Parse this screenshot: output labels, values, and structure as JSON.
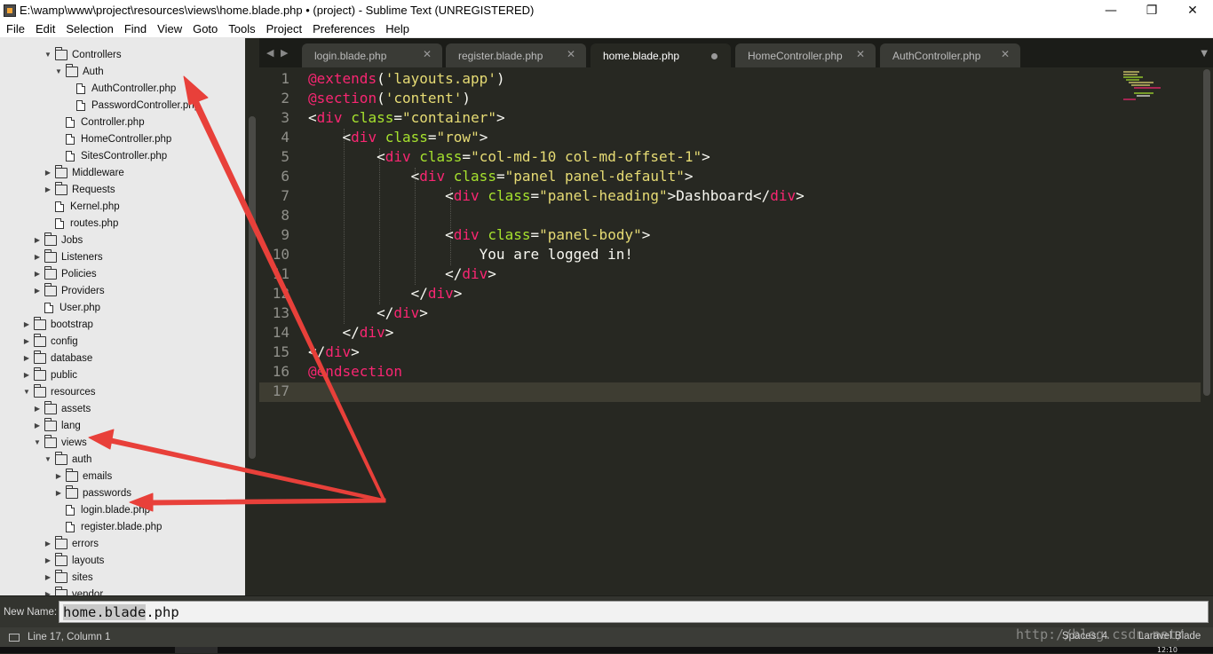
{
  "window": {
    "title": "E:\\wamp\\www\\project\\resources\\views\\home.blade.php • (project) - Sublime Text (UNREGISTERED)",
    "minimize": "—",
    "maximize": "❐",
    "close": "✕"
  },
  "menu": [
    "File",
    "Edit",
    "Selection",
    "Find",
    "View",
    "Goto",
    "Tools",
    "Project",
    "Preferences",
    "Help"
  ],
  "sidebar": {
    "items": [
      {
        "label": "Controllers",
        "type": "folder",
        "state": "open"
      },
      {
        "label": "Auth",
        "type": "folder",
        "state": "open"
      },
      {
        "label": "AuthController.php",
        "type": "file"
      },
      {
        "label": "PasswordController.php",
        "type": "file"
      },
      {
        "label": "Controller.php",
        "type": "file"
      },
      {
        "label": "HomeController.php",
        "type": "file"
      },
      {
        "label": "SitesController.php",
        "type": "file"
      },
      {
        "label": "Middleware",
        "type": "folder",
        "state": "closed"
      },
      {
        "label": "Requests",
        "type": "folder",
        "state": "closed"
      },
      {
        "label": "Kernel.php",
        "type": "file"
      },
      {
        "label": "routes.php",
        "type": "file"
      },
      {
        "label": "Jobs",
        "type": "folder",
        "state": "closed"
      },
      {
        "label": "Listeners",
        "type": "folder",
        "state": "closed"
      },
      {
        "label": "Policies",
        "type": "folder",
        "state": "closed"
      },
      {
        "label": "Providers",
        "type": "folder",
        "state": "closed"
      },
      {
        "label": "User.php",
        "type": "file"
      },
      {
        "label": "bootstrap",
        "type": "folder",
        "state": "closed"
      },
      {
        "label": "config",
        "type": "folder",
        "state": "closed"
      },
      {
        "label": "database",
        "type": "folder",
        "state": "closed"
      },
      {
        "label": "public",
        "type": "folder",
        "state": "closed"
      },
      {
        "label": "resources",
        "type": "folder",
        "state": "open"
      },
      {
        "label": "assets",
        "type": "folder",
        "state": "closed"
      },
      {
        "label": "lang",
        "type": "folder",
        "state": "closed"
      },
      {
        "label": "views",
        "type": "folder",
        "state": "open"
      },
      {
        "label": "auth",
        "type": "folder",
        "state": "open"
      },
      {
        "label": "emails",
        "type": "folder",
        "state": "closed"
      },
      {
        "label": "passwords",
        "type": "folder",
        "state": "closed"
      },
      {
        "label": "login.blade.php",
        "type": "file"
      },
      {
        "label": "register.blade.php",
        "type": "file"
      },
      {
        "label": "errors",
        "type": "folder",
        "state": "closed"
      },
      {
        "label": "layouts",
        "type": "folder",
        "state": "closed"
      },
      {
        "label": "sites",
        "type": "folder",
        "state": "closed"
      },
      {
        "label": "vendor",
        "type": "folder",
        "state": "closed"
      }
    ]
  },
  "tabs": [
    {
      "label": "login.blade.php",
      "active": false,
      "dirty": false
    },
    {
      "label": "register.blade.php",
      "active": false,
      "dirty": false
    },
    {
      "label": "home.blade.php",
      "active": true,
      "dirty": true
    },
    {
      "label": "HomeController.php",
      "active": false,
      "dirty": false
    },
    {
      "label": "AuthController.php",
      "active": false,
      "dirty": false
    }
  ],
  "tab_nav": {
    "left": "◀",
    "right": "▶",
    "menu": "▼"
  },
  "editor": {
    "lines": [
      [
        {
          "t": "@",
          "c": "kw"
        },
        {
          "t": "extends",
          "c": "kw"
        },
        {
          "t": "(",
          "c": "plain"
        },
        {
          "t": "'layouts.app'",
          "c": "str"
        },
        {
          "t": ")",
          "c": "plain"
        }
      ],
      [
        {
          "t": "@",
          "c": "kw"
        },
        {
          "t": "section",
          "c": "kw"
        },
        {
          "t": "(",
          "c": "plain"
        },
        {
          "t": "'content'",
          "c": "str"
        },
        {
          "t": ")",
          "c": "plain"
        }
      ],
      [
        {
          "t": "<",
          "c": "plain"
        },
        {
          "t": "div",
          "c": "tg"
        },
        {
          "t": " ",
          "c": "plain"
        },
        {
          "t": "class",
          "c": "att"
        },
        {
          "t": "=",
          "c": "plain"
        },
        {
          "t": "\"container\"",
          "c": "str"
        },
        {
          "t": ">",
          "c": "plain"
        }
      ],
      [
        {
          "t": "    <",
          "c": "plain"
        },
        {
          "t": "div",
          "c": "tg"
        },
        {
          "t": " ",
          "c": "plain"
        },
        {
          "t": "class",
          "c": "att"
        },
        {
          "t": "=",
          "c": "plain"
        },
        {
          "t": "\"row\"",
          "c": "str"
        },
        {
          "t": ">",
          "c": "plain"
        }
      ],
      [
        {
          "t": "        <",
          "c": "plain"
        },
        {
          "t": "div",
          "c": "tg"
        },
        {
          "t": " ",
          "c": "plain"
        },
        {
          "t": "class",
          "c": "att"
        },
        {
          "t": "=",
          "c": "plain"
        },
        {
          "t": "\"col-md-10 col-md-offset-1\"",
          "c": "str"
        },
        {
          "t": ">",
          "c": "plain"
        }
      ],
      [
        {
          "t": "            <",
          "c": "plain"
        },
        {
          "t": "div",
          "c": "tg"
        },
        {
          "t": " ",
          "c": "plain"
        },
        {
          "t": "class",
          "c": "att"
        },
        {
          "t": "=",
          "c": "plain"
        },
        {
          "t": "\"panel panel-default\"",
          "c": "str"
        },
        {
          "t": ">",
          "c": "plain"
        }
      ],
      [
        {
          "t": "                <",
          "c": "plain"
        },
        {
          "t": "div",
          "c": "tg"
        },
        {
          "t": " ",
          "c": "plain"
        },
        {
          "t": "class",
          "c": "att"
        },
        {
          "t": "=",
          "c": "plain"
        },
        {
          "t": "\"panel-heading\"",
          "c": "str"
        },
        {
          "t": ">Dashboard</",
          "c": "plain"
        },
        {
          "t": "div",
          "c": "tg"
        },
        {
          "t": ">",
          "c": "plain"
        }
      ],
      [],
      [
        {
          "t": "                <",
          "c": "plain"
        },
        {
          "t": "div",
          "c": "tg"
        },
        {
          "t": " ",
          "c": "plain"
        },
        {
          "t": "class",
          "c": "att"
        },
        {
          "t": "=",
          "c": "plain"
        },
        {
          "t": "\"panel-body\"",
          "c": "str"
        },
        {
          "t": ">",
          "c": "plain"
        }
      ],
      [
        {
          "t": "                    You are logged in!",
          "c": "plain"
        }
      ],
      [
        {
          "t": "                </",
          "c": "plain"
        },
        {
          "t": "div",
          "c": "tg"
        },
        {
          "t": ">",
          "c": "plain"
        }
      ],
      [
        {
          "t": "            </",
          "c": "plain"
        },
        {
          "t": "div",
          "c": "tg"
        },
        {
          "t": ">",
          "c": "plain"
        }
      ],
      [
        {
          "t": "        </",
          "c": "plain"
        },
        {
          "t": "div",
          "c": "tg"
        },
        {
          "t": ">",
          "c": "plain"
        }
      ],
      [
        {
          "t": "    </",
          "c": "plain"
        },
        {
          "t": "div",
          "c": "tg"
        },
        {
          "t": ">",
          "c": "plain"
        }
      ],
      [
        {
          "t": "</",
          "c": "plain"
        },
        {
          "t": "div",
          "c": "tg"
        },
        {
          "t": ">",
          "c": "plain"
        }
      ],
      [
        {
          "t": "@",
          "c": "kw"
        },
        {
          "t": "endsection",
          "c": "kw"
        }
      ],
      []
    ]
  },
  "input_panel": {
    "label": "New Name:",
    "value_selected": "home.blade",
    "value_rest": ".php"
  },
  "status": {
    "position": "Line 17, Column 1",
    "spaces": "Spaces: 4",
    "syntax": "Laravel Blade"
  },
  "watermark": "http://blog.csdn.net/",
  "clock": "12:10",
  "colors": {
    "editor_bg": "#272822",
    "keyword": "#f92672",
    "string": "#e6db74",
    "attribute": "#a6e22e",
    "sidebar_bg": "#e9e9e9",
    "annotation_arrow": "#e8403a"
  }
}
